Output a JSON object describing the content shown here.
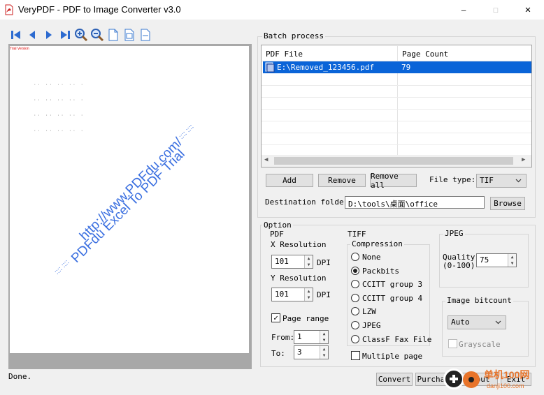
{
  "window": {
    "title": "VeryPDF - PDF to Image Converter v3.0",
    "minimize_glyph": "—",
    "maximize_glyph": "☐",
    "close_glyph": "✕"
  },
  "toolbar": {
    "icons": [
      "first-page-icon",
      "prev-page-icon",
      "next-page-icon",
      "last-page-icon",
      "zoom-in-icon",
      "zoom-out-icon",
      "page-icon",
      "fit-page-icon",
      "fit-width-icon"
    ]
  },
  "preview": {
    "trial_text": "Trial Version",
    "watermark_line1": "http://www.PDFdu.com/",
    "watermark_line2": "PDFdu Excel To PDF Trial",
    "watermark_dots": ":::: ::::"
  },
  "batch": {
    "group_label": "Batch process",
    "col_file": "PDF File",
    "col_count": "Page Count",
    "rows": [
      {
        "file": "E:\\Removed_123456.pdf",
        "count": "79"
      }
    ],
    "add_label": "Add",
    "remove_label": "Remove",
    "remove_all_label": "Remove all",
    "filetype_label": "File type:",
    "filetype_value": "TIF",
    "dest_label": "Destination folder",
    "dest_value": "D:\\tools\\桌面\\office",
    "browse_label": "Browse"
  },
  "option": {
    "group_label": "Option",
    "pdf": {
      "label": "PDF",
      "x_res_label": "X Resolution",
      "x_res_value": "101",
      "y_res_label": "Y Resolution",
      "y_res_value": "101",
      "dpi_label": "DPI",
      "page_range_label": "Page range",
      "page_range_checked": true,
      "from_label": "From:",
      "from_value": "1",
      "to_label": "To:",
      "to_value": "3"
    },
    "tiff": {
      "label": "TIFF",
      "compression_label": "Compression",
      "options": [
        "None",
        "Packbits",
        "CCITT group 3",
        "CCITT group 4",
        "LZW",
        "JPEG",
        "ClassF Fax File"
      ],
      "selected": "Packbits",
      "multipage_label": "Multiple page"
    },
    "jpeg": {
      "label": "JPEG",
      "quality_label": "Quality",
      "quality_range": "(0-100)",
      "quality_value": "75"
    },
    "bitcount": {
      "label": "Image bitcount",
      "value": "Auto",
      "grayscale_label": "Grayscale"
    }
  },
  "footer": {
    "status": "Done.",
    "convert_label": "Convert",
    "purchase_label": "Purchase",
    "about_label": "About",
    "exit_label": "Exit",
    "site_logo_text": "单机100网",
    "site_logo_url": "danji100.com"
  }
}
